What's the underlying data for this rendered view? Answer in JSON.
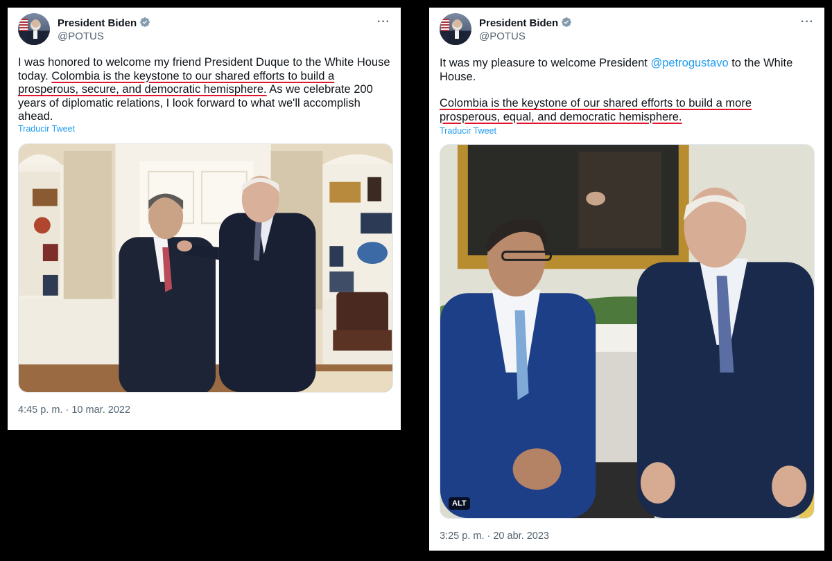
{
  "tweets": [
    {
      "author_name": "President Biden",
      "handle": "@POTUS",
      "text_part1": "I was honored to welcome my friend President Duque to the White House today. ",
      "text_underlined": "Colombia is the keystone to our shared efforts to build a prosperous, secure, and democratic hemisphere.",
      "text_part2": " As we celebrate 200 years of diplomatic relations, I look forward to what we'll accomplish ahead.",
      "translate_label": "Traducir Tweet",
      "timestamp": "4:45 p. m. · 10 mar. 2022"
    },
    {
      "author_name": "President Biden",
      "handle": "@POTUS",
      "text_part1": "It was my pleasure to welcome President ",
      "mention": "@petrogustavo",
      "text_part1b": " to the White House.",
      "text_underlined": "Colombia is the keystone of our shared efforts to build a more prosperous, equal, and democratic hemisphere.",
      "translate_label": "Traducir Tweet",
      "alt_badge": "ALT",
      "timestamp": "3:25 p. m. · 20 abr. 2023"
    }
  ],
  "icons": {
    "verified": "verified-badge-icon",
    "more": "more-options-icon"
  },
  "colors": {
    "link": "#1d9bf0",
    "underline": "#e0142a",
    "verified": "#829aab"
  },
  "more_glyph": "···"
}
